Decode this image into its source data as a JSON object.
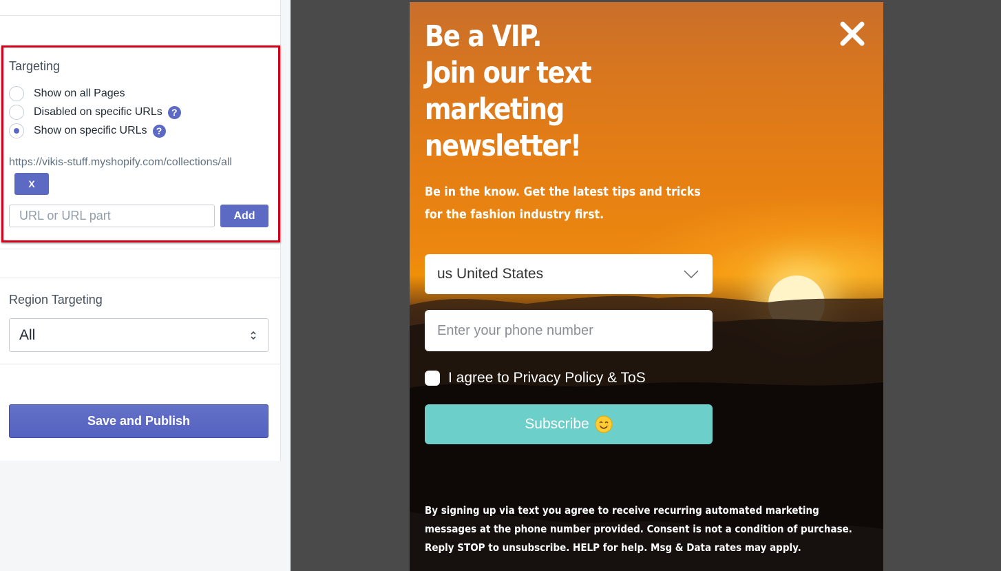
{
  "settings": {
    "targeting": {
      "title": "Targeting",
      "options": [
        {
          "label": "Show on all Pages",
          "selected": false,
          "help": ""
        },
        {
          "label": "Disabled on specific URLs",
          "selected": false,
          "help": "?"
        },
        {
          "label": "Show on specific URLs",
          "selected": true,
          "help": "?"
        }
      ],
      "url": "https://vikis-stuff.myshopify.com/collections/all",
      "remove_label": "X",
      "url_placeholder": "URL or URL part",
      "add_label": "Add"
    },
    "region": {
      "title": "Region Targeting",
      "value": "All"
    },
    "save_label": "Save and Publish"
  },
  "popup": {
    "headline": [
      "Be a VIP.",
      "Join our text",
      "marketing",
      "newsletter!"
    ],
    "subheading": "Be in the know. Get the latest tips and tricks for the fashion industry first.",
    "country": "us United States",
    "phone_placeholder": "Enter your phone number",
    "agree_label": "I agree to Privacy Policy & ToS",
    "subscribe_label": "Subscribe",
    "disclaimer": "By signing up via text you agree to receive recurring automated marketing messages at the phone number provided. Consent is not a condition of purchase. Reply STOP to unsubscribe. HELP for help. Msg & Data rates may apply.",
    "colors": {
      "subscribe": "#6ccfca",
      "accent": "#5c6ac4",
      "highlight_border": "#d0021b"
    }
  }
}
